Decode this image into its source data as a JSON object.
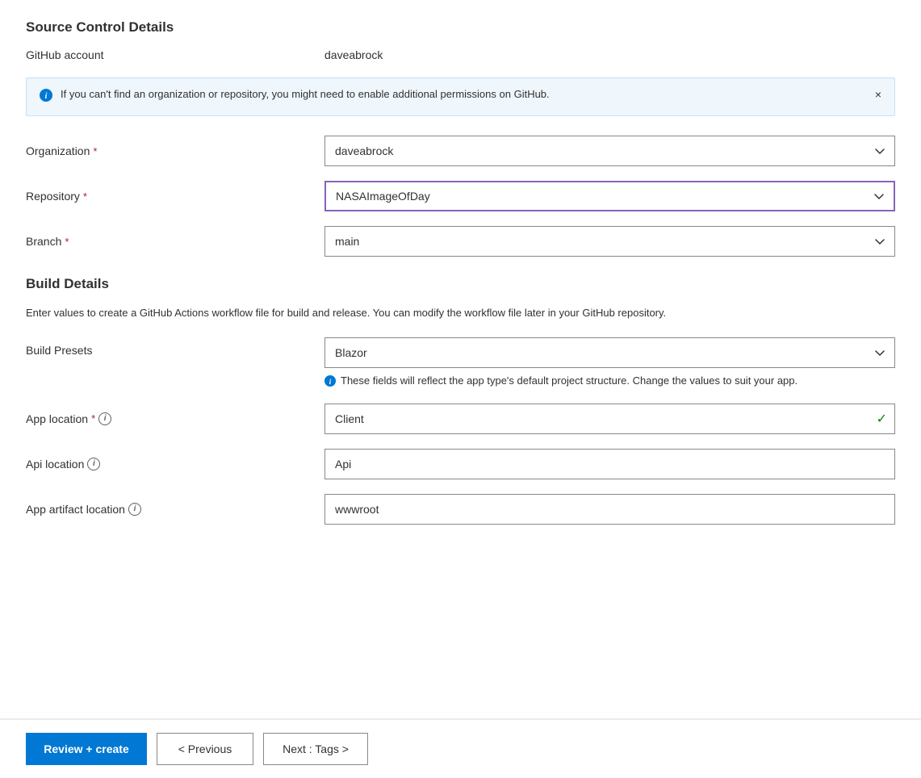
{
  "page": {
    "source_control": {
      "title": "Source Control Details",
      "github_account_label": "GitHub account",
      "github_account_value": "daveabrock",
      "info_banner": {
        "text": "If you can't find an organization or repository, you might need to enable additional permissions on GitHub."
      },
      "organization_label": "Organization",
      "organization_value": "daveabrock",
      "repository_label": "Repository",
      "repository_value": "NASAImageOfDay",
      "branch_label": "Branch",
      "branch_value": "main"
    },
    "build_details": {
      "title": "Build Details",
      "description": "Enter values to create a GitHub Actions workflow file for build and release. You can modify the workflow file later in your GitHub repository.",
      "build_presets_label": "Build Presets",
      "build_presets_value": "Blazor",
      "preset_hint": "These fields will reflect the app type's default project structure. Change the values to suit your app.",
      "app_location_label": "App location",
      "app_location_value": "Client",
      "api_location_label": "Api location",
      "api_location_value": "Api",
      "app_artifact_label": "App artifact location",
      "app_artifact_value": "wwwroot"
    },
    "footer": {
      "review_create_label": "Review + create",
      "previous_label": "< Previous",
      "next_label": "Next : Tags >"
    }
  },
  "icons": {
    "chevron": "⌄",
    "close": "×",
    "info_circle": "i",
    "check": "✓"
  }
}
